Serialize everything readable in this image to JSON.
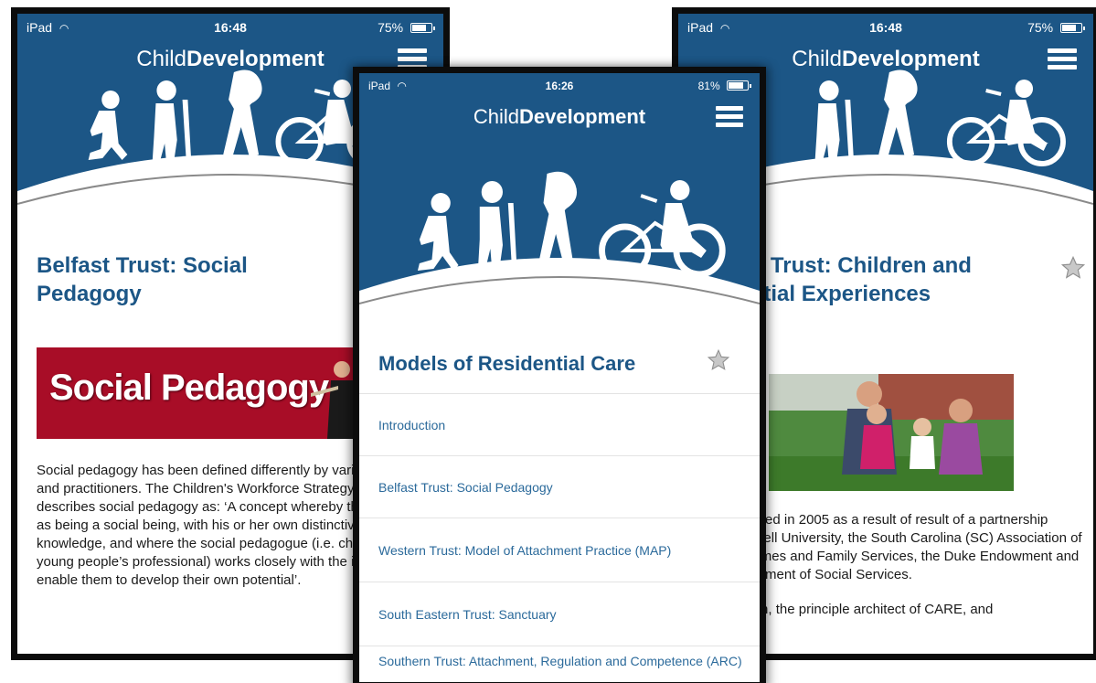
{
  "app": {
    "title_light": "Child",
    "title_bold": "Development"
  },
  "left_screen": {
    "status": {
      "carrier": "iPad",
      "time": "16:48",
      "battery": "75%",
      "battery_level": 0.75
    },
    "heading": "Belfast Trust: Social Pedagogy",
    "banner_text": "Social Pedagogy",
    "body": "Social pedagogy has been defined differently by various authors and practitioners. The Children's Workforce Strategy (2005) describes social pedagogy as: ‘A concept whereby the child is seen as being a social being, with his or her own distinctive being and knowledge, and where the social pedagogue (i.e. children and young people’s professional) works closely with the individual to enable them to develop their own potential’."
  },
  "center_screen": {
    "status": {
      "carrier": "iPad",
      "time": "16:26",
      "battery": "81%",
      "battery_level": 0.81
    },
    "heading": "Models of Residential Care",
    "menu_items": [
      "Introduction",
      "Belfast Trust: Social Pedagogy",
      "Western Trust: Model of Attachment Practice (MAP)",
      "South Eastern Trust: Sanctuary",
      "Southern Trust: Attachment, Regulation and Competence (ARC)"
    ]
  },
  "right_screen": {
    "status": {
      "carrier": "iPad",
      "time": "16:48",
      "battery": "75%",
      "battery_level": 0.75
    },
    "heading": "Western Trust: Children and Residential Experiences (CARE)",
    "body_1": "CARE originated in 2005 as a result of result of a partnership between Cornell University, the South Carolina (SC) Association of Children’s Homes and Family Services, the Duke Endowment and the SC Department of Social Services.",
    "body_2": "Martha Holden, the principle architect of CARE, and"
  },
  "colors": {
    "header_blue": "#1c5686",
    "heading_blue": "#1c5686",
    "link_blue": "#2b6a9b",
    "banner_red": "#a80d27"
  },
  "icons": [
    "wifi-icon",
    "battery-icon",
    "menu-icon",
    "star-icon"
  ]
}
